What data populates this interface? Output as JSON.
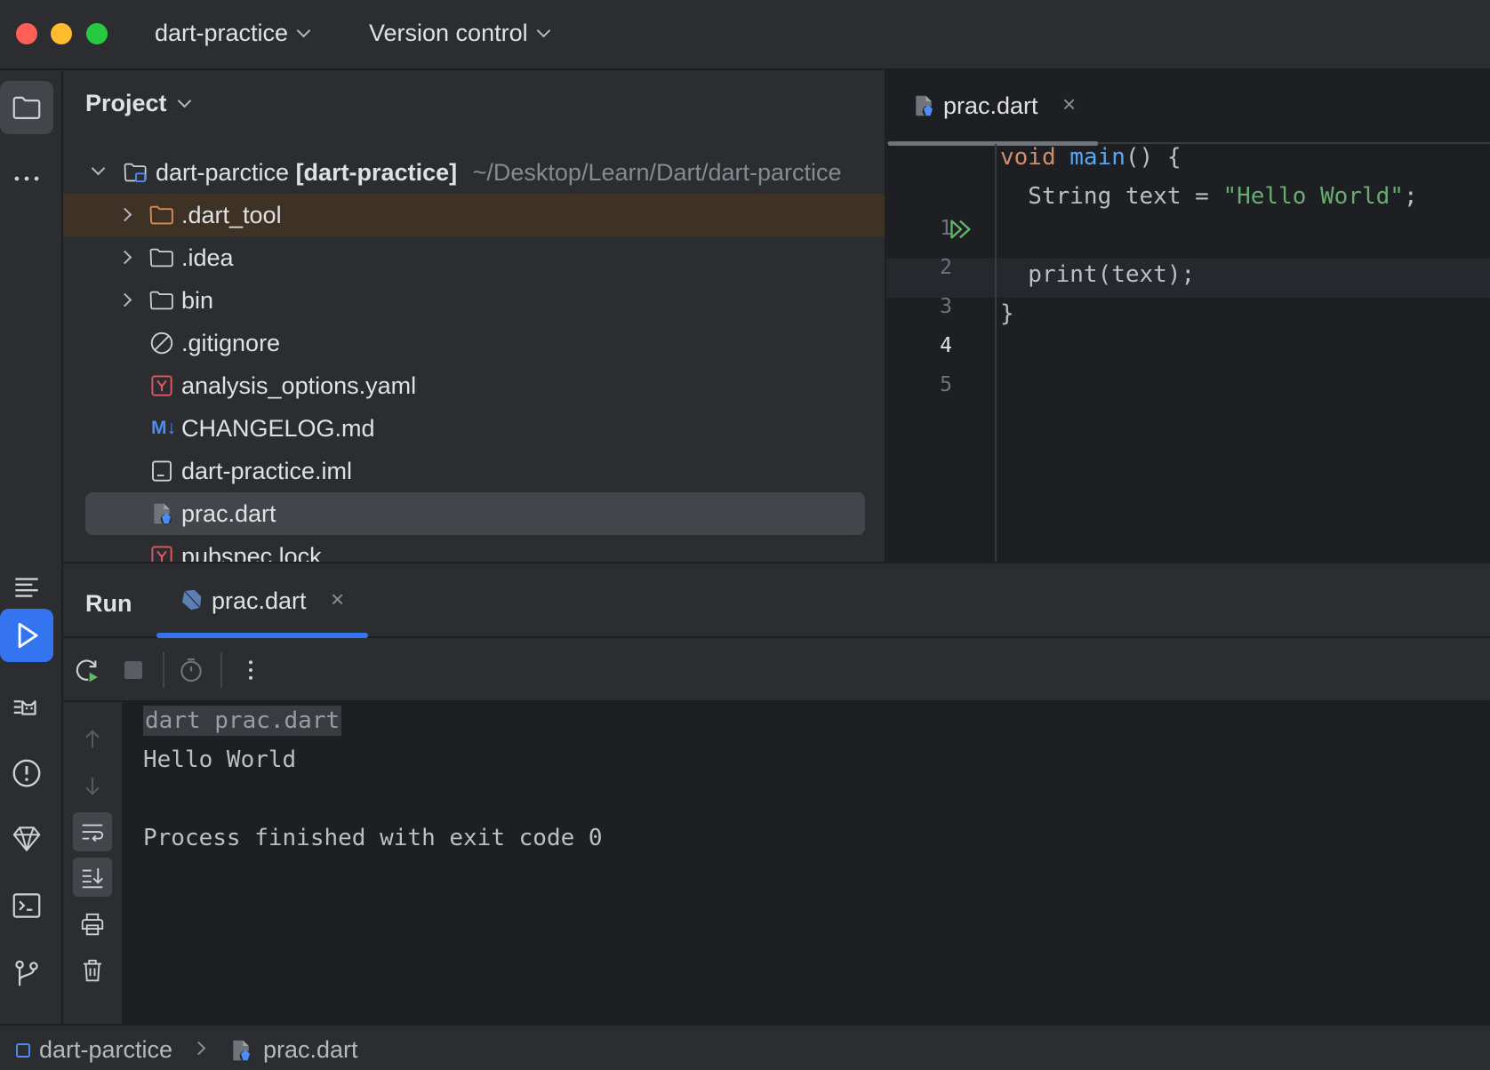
{
  "titlebar": {
    "project_name": "dart-practice",
    "vcs": "Version control"
  },
  "project_panel": {
    "title": "Project",
    "root": {
      "name": "dart-parctice [dart-practice]",
      "name_plain": "dart-parctice ",
      "name_bold": "[dart-practice]",
      "path": "~/Desktop/Learn/Dart/dart-parctice"
    },
    "items": [
      {
        "label": ".dart_tool",
        "type": "folder-excluded",
        "icon": "folder-orange-icon"
      },
      {
        "label": ".idea",
        "type": "folder",
        "icon": "folder-icon"
      },
      {
        "label": "bin",
        "type": "folder",
        "icon": "folder-icon"
      },
      {
        "label": ".gitignore",
        "type": "file",
        "icon": "ignore-file-icon"
      },
      {
        "label": "analysis_options.yaml",
        "type": "file",
        "icon": "yaml-icon"
      },
      {
        "label": "CHANGELOG.md",
        "type": "file",
        "icon": "markdown-icon"
      },
      {
        "label": "dart-practice.iml",
        "type": "file",
        "icon": "iml-file-icon"
      },
      {
        "label": "prac.dart",
        "type": "file",
        "icon": "dart-file-icon"
      },
      {
        "label": "pubspec.lock",
        "type": "file",
        "icon": "yaml-icon"
      }
    ]
  },
  "editor": {
    "tab_label": "prac.dart",
    "line_numbers": [
      "1",
      "2",
      "3",
      "4",
      "5"
    ],
    "code": {
      "l1_kw": "void",
      "l1_fn": "main",
      "l1_rest": "() {",
      "l2_a": "  String text = ",
      "l2_str": "\"Hello World\"",
      "l2_end": ";",
      "l3": "",
      "l4": "  print(text);",
      "l5": "}"
    },
    "current_line": "4"
  },
  "run_panel": {
    "title": "Run",
    "tab_label": "prac.dart",
    "console": {
      "command": "dart prac.dart",
      "output": "Hello World",
      "exit": "Process finished with exit code 0"
    }
  },
  "statusbar": {
    "project": "dart-parctice",
    "file": "prac.dart"
  },
  "colors": {
    "accent": "#3574f0",
    "keyword": "#cf8e6d",
    "function": "#56a8f5",
    "string": "#6aab73",
    "run_green": "#5fb865"
  }
}
